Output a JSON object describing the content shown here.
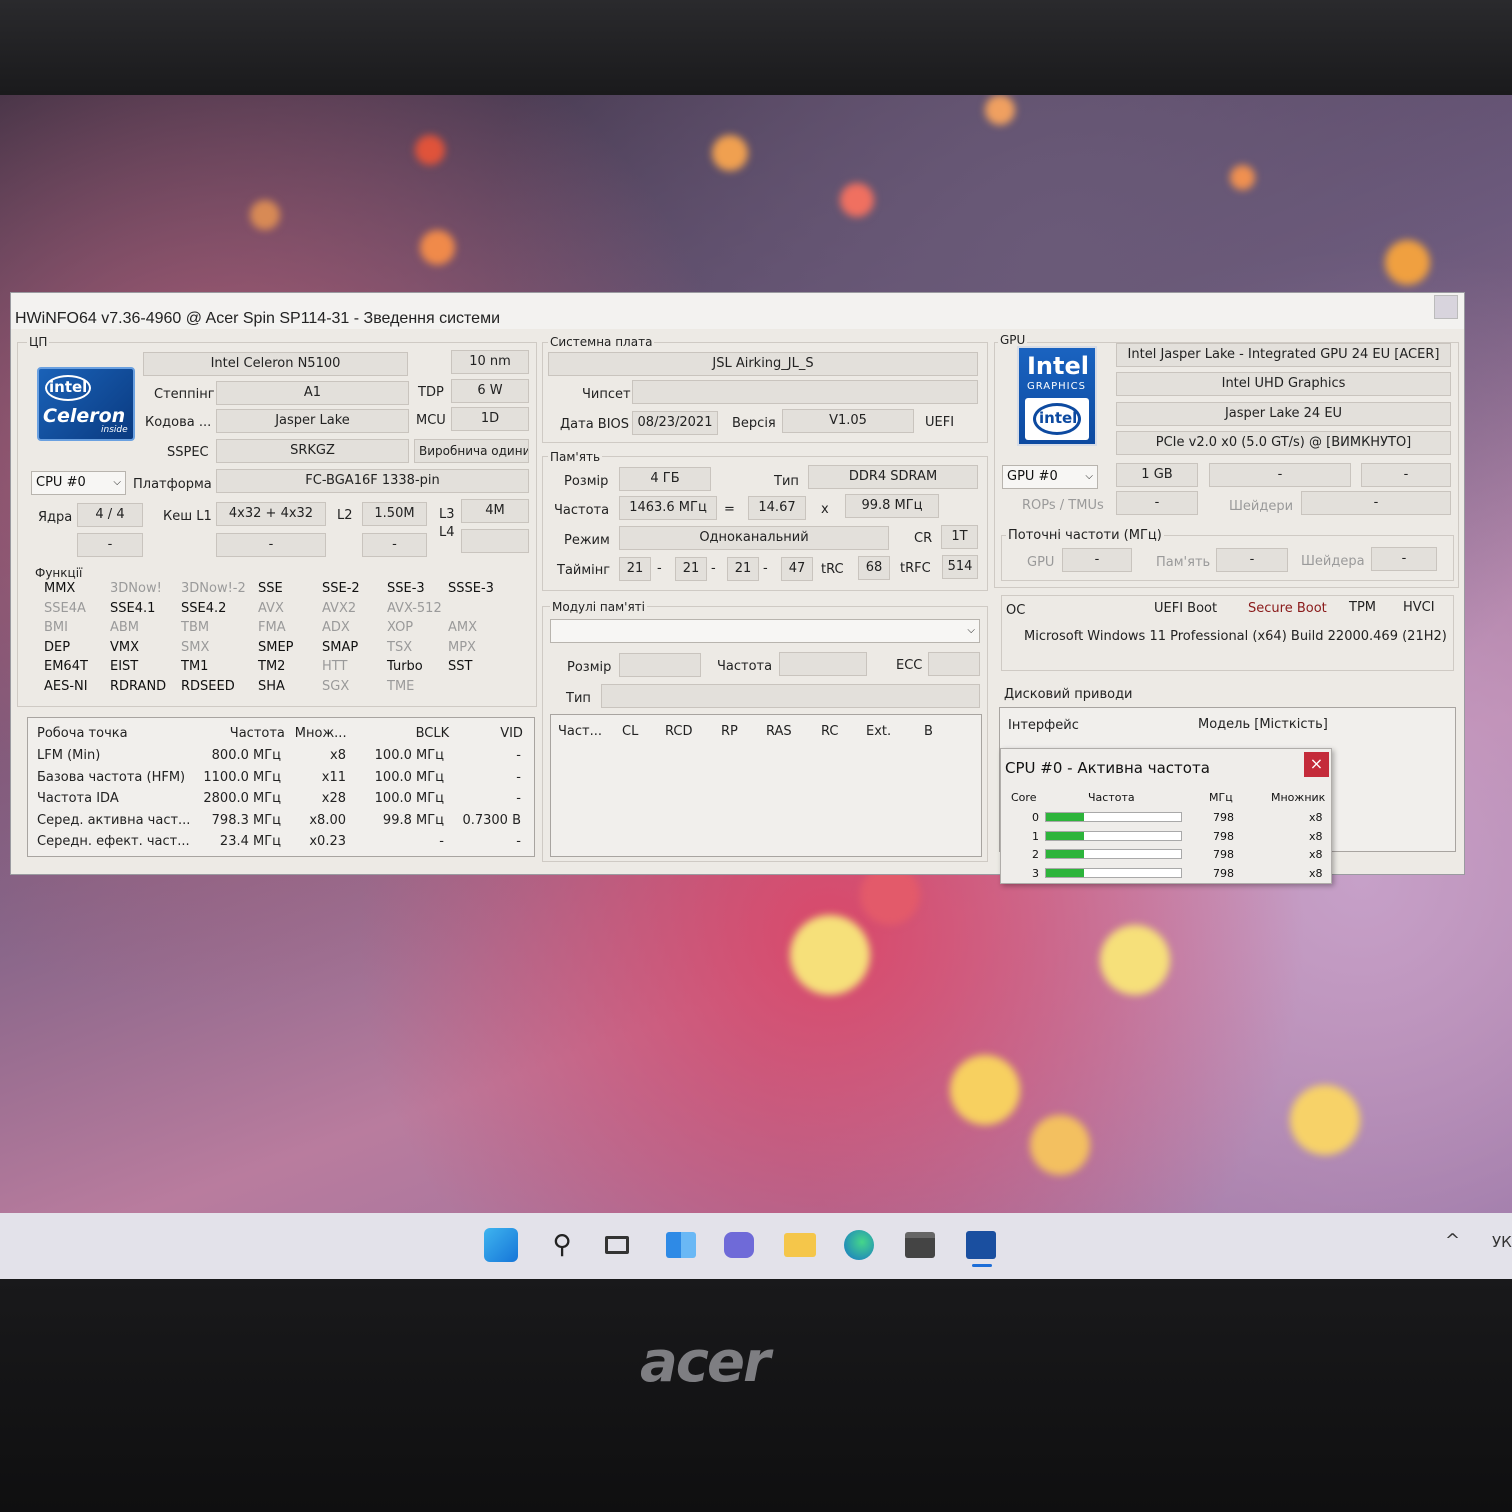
{
  "window": {
    "title": "HWiNFO64 v7.36-4960 @ Acer Spin SP114-31 - Зведення системи"
  },
  "cpu": {
    "group_label": "ЦП",
    "logo_brand": "intel",
    "logo_name": "Celeron",
    "logo_sub": "inside",
    "name": "Intel Celeron N5100",
    "process": "10 nm",
    "stepping_label": "Степпінг",
    "stepping": "A1",
    "tdp_label": "TDP",
    "tdp": "6 W",
    "codename_label": "Кодова ...",
    "codename": "Jasper Lake",
    "mcu_label": "MCU",
    "mcu": "1D",
    "sspec_label": "SSPEC",
    "sspec": "SRKGZ",
    "prod_unit": "Виробнича одини",
    "selector": "CPU #0",
    "platform_label": "Платформа",
    "platform": "FC-BGA16F 1338-pin",
    "cores_label": "Ядра",
    "cores": "4 / 4",
    "l1_label": "Кеш L1",
    "l1": "4x32 + 4x32",
    "l2_label": "L2",
    "l2": "1.50M",
    "l3_label": "L3",
    "l3": "4M",
    "l4_label": "L4",
    "dash": "-"
  },
  "features": {
    "label": "Функції",
    "rows": [
      [
        {
          "t": "MMX",
          "on": true
        },
        {
          "t": "3DNow!",
          "on": false
        },
        {
          "t": "3DNow!-2",
          "on": false
        },
        {
          "t": "SSE",
          "on": true
        },
        {
          "t": "SSE-2",
          "on": true
        },
        {
          "t": "SSE-3",
          "on": true
        },
        {
          "t": "SSSE-3",
          "on": true
        }
      ],
      [
        {
          "t": "SSE4A",
          "on": false
        },
        {
          "t": "SSE4.1",
          "on": true
        },
        {
          "t": "SSE4.2",
          "on": true
        },
        {
          "t": "AVX",
          "on": false
        },
        {
          "t": "AVX2",
          "on": false
        },
        {
          "t": "AVX-512",
          "on": false
        }
      ],
      [
        {
          "t": "BMI",
          "on": false
        },
        {
          "t": "ABM",
          "on": false
        },
        {
          "t": "TBM",
          "on": false
        },
        {
          "t": "FMA",
          "on": false
        },
        {
          "t": "ADX",
          "on": false
        },
        {
          "t": "XOP",
          "on": false
        },
        {
          "t": "AMX",
          "on": false
        }
      ],
      [
        {
          "t": "DEP",
          "on": true
        },
        {
          "t": "VMX",
          "on": true
        },
        {
          "t": "SMX",
          "on": false
        },
        {
          "t": "SMEP",
          "on": true
        },
        {
          "t": "SMAP",
          "on": true
        },
        {
          "t": "TSX",
          "on": false
        },
        {
          "t": "MPX",
          "on": false
        }
      ],
      [
        {
          "t": "EM64T",
          "on": true
        },
        {
          "t": "EIST",
          "on": true
        },
        {
          "t": "TM1",
          "on": true
        },
        {
          "t": "TM2",
          "on": true
        },
        {
          "t": "HTT",
          "on": false
        },
        {
          "t": "Turbo",
          "on": true
        },
        {
          "t": "SST",
          "on": true
        }
      ],
      [
        {
          "t": "AES-NI",
          "on": true
        },
        {
          "t": "RDRAND",
          "on": true
        },
        {
          "t": "RDSEED",
          "on": true
        },
        {
          "t": "SHA",
          "on": true
        },
        {
          "t": "SGX",
          "on": false
        },
        {
          "t": "TME",
          "on": false
        }
      ]
    ]
  },
  "op_table": {
    "headers": [
      "Робоча точка",
      "Частота",
      "Множ...",
      "BCLK",
      "VID"
    ],
    "rows": [
      [
        "LFM (Min)",
        "800.0 МГц",
        "x8",
        "100.0 МГц",
        "-"
      ],
      [
        "Базова частота (HFM)",
        "1100.0 МГц",
        "x11",
        "100.0 МГц",
        "-"
      ],
      [
        "Частота IDA",
        "2800.0 МГц",
        "x28",
        "100.0 МГц",
        "-"
      ],
      [
        "Серед. активна част...",
        "798.3 МГц",
        "x8.00",
        "99.8 МГц",
        "0.7300 В"
      ],
      [
        "Середн. ефект. част...",
        "23.4 МГц",
        "x0.23",
        "-",
        "-"
      ]
    ]
  },
  "mobo": {
    "group_label": "Системна плата",
    "name": "JSL Airking_JL_S",
    "chipset_label": "Чипсет",
    "chipset": "",
    "bios_date_label": "Дата BIOS",
    "bios_date": "08/23/2021",
    "version_label": "Версія",
    "version": "V1.05",
    "uefi": "UEFI"
  },
  "memory": {
    "group_label": "Пам'ять",
    "size_label": "Розмір",
    "size": "4 ГБ",
    "type_label": "Тип",
    "type": "DDR4 SDRAM",
    "freq_label": "Частота",
    "freq": "1463.6 МГц",
    "eq": "=",
    "mult": "14.67",
    "x": "x",
    "bclk": "99.8 МГц",
    "mode_label": "Режим",
    "mode": "Одноканальний",
    "cr_label": "CR",
    "cr": "1T",
    "timing_label": "Таймінг",
    "t1": "21",
    "t2": "21",
    "t3": "21",
    "t4": "47",
    "trc_label": "tRC",
    "trc": "68",
    "trfc_label": "tRFC",
    "trfc": "514",
    "sep": "-"
  },
  "modules": {
    "group_label": "Модулі пам'яті",
    "size_label": "Розмір",
    "freq_label": "Частота",
    "ecc_label": "ECC",
    "type_label": "Тип",
    "table_headers": [
      "Част...",
      "CL",
      "RCD",
      "RP",
      "RAS",
      "RC",
      "Ext.",
      "B"
    ]
  },
  "gpu": {
    "group_label": "GPU",
    "logo_brand": "Intel",
    "logo_sub": "GRAPHICS",
    "logo_badge": "intel",
    "name": "Intel Jasper Lake - Integrated GPU 24 EU [ACER]",
    "model": "Intel UHD Graphics",
    "core": "Jasper Lake 24 EU",
    "bus": "PCIe v2.0 x0 (5.0 GT/s) @ [ВИМКНУТО]",
    "selector": "GPU #0",
    "vram": "1 GB",
    "dash": "-",
    "rops_label": "ROPs / TMUs",
    "shaders_label": "Шейдери",
    "clocks_label": "Поточні частоти (МГц)",
    "clk_gpu_label": "GPU",
    "clk_mem_label": "Пам'ять",
    "clk_shader_label": "Шейдера"
  },
  "os": {
    "label": "ОС",
    "uefi_boot": "UEFI Boot",
    "secure_boot": "Secure Boot",
    "tpm": "TPM",
    "hvci": "HVCI",
    "name": "Microsoft Windows 11 Professional (x64) Build 22000.469 (21H2)"
  },
  "drives": {
    "label": "Дисковий приводи",
    "interface_label": "Інтерфейс",
    "model_label": "Модель [Місткість]"
  },
  "popup": {
    "title": "CPU #0 - Активна частота",
    "close": "×",
    "headers": [
      "Core",
      "Частота",
      "МГц",
      "Множник"
    ],
    "rows": [
      {
        "core": "0",
        "mhz": "798",
        "mult": "x8",
        "fill": 0.28
      },
      {
        "core": "1",
        "mhz": "798",
        "mult": "x8",
        "fill": 0.28
      },
      {
        "core": "2",
        "mhz": "798",
        "mult": "x8",
        "fill": 0.28
      },
      {
        "core": "3",
        "mhz": "798",
        "mult": "x8",
        "fill": 0.28
      }
    ]
  },
  "taskbar": {
    "icons": [
      "start-icon",
      "search-icon",
      "task-view-icon",
      "widgets-icon",
      "chat-icon",
      "file-explorer-icon",
      "edge-icon",
      "store-icon",
      "hwinfo-icon"
    ],
    "lang": "УК",
    "tray_chevron": "^"
  },
  "laptop": {
    "brand": "acer"
  },
  "colors": {
    "accent_blue": "#0071c5",
    "popup_close": "#c42b3a",
    "bar_green": "#2db43b"
  }
}
